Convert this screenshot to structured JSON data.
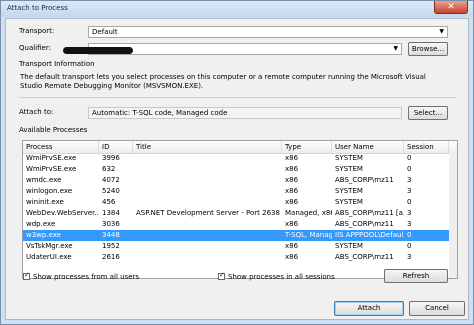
{
  "window": {
    "title": "Attach to Process",
    "close_glyph": "✕"
  },
  "transport": {
    "label": "Transport:",
    "value": "Default"
  },
  "qualifier": {
    "label": "Qualifier:",
    "browse_label": "Browse..."
  },
  "transport_info": {
    "header": "Transport Information",
    "text": "The default transport lets you select processes on this computer or a remote computer running the Microsoft Visual Studio Remote Debugging Monitor (MSVSMON.EXE)."
  },
  "attach_to": {
    "label": "Attach to:",
    "value": "Automatic: T-SQL code, Managed code",
    "select_label": "Select..."
  },
  "available": {
    "header": "Available Processes",
    "columns": [
      "Process",
      "ID",
      "Title",
      "Type",
      "User Name",
      "Session"
    ],
    "rows": [
      [
        "WmiPrvSE.exe",
        "3996",
        "",
        "x86",
        "SYSTEM",
        "0"
      ],
      [
        "WmiPrvSE.exe",
        "632",
        "",
        "x86",
        "SYSTEM",
        "0"
      ],
      [
        "wmdc.exe",
        "4072",
        "",
        "x86",
        "ABS_CORP\\mz11",
        "3"
      ],
      [
        "winlogon.exe",
        "5240",
        "",
        "x86",
        "SYSTEM",
        "3"
      ],
      [
        "wininit.exe",
        "456",
        "",
        "x86",
        "SYSTEM",
        "0"
      ],
      [
        "WebDev.WebServer...",
        "1384",
        "ASP.NET Development Server - Port 2638",
        "Managed, x86",
        "ABS_CORP\\mz11 [a...",
        "3"
      ],
      [
        "wdp.exe",
        "3036",
        "",
        "x86",
        "ABS_CORP\\mz11",
        "3"
      ],
      [
        "w3wp.exe",
        "3448",
        "",
        "T-SQL, Manag...",
        "IIS APPPOOL\\Defaul...",
        "0"
      ],
      [
        "VsTskMgr.exe",
        "1952",
        "",
        "x86",
        "SYSTEM",
        "0"
      ],
      [
        "UdaterUI.exe",
        "2616",
        "",
        "x86",
        "ABS_CORP\\mz11",
        "3"
      ]
    ],
    "selected_row_index": 7
  },
  "options": {
    "show_all_users": {
      "label": "Show processes from all users",
      "checked": true
    },
    "show_all_sessions": {
      "label": "Show processes in all sessions",
      "checked": true
    },
    "refresh_label": "Refresh"
  },
  "footer": {
    "attach_label": "Attach",
    "cancel_label": "Cancel"
  }
}
